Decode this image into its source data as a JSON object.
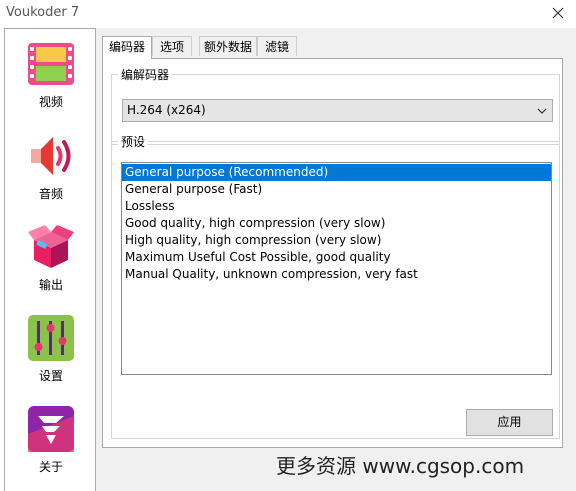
{
  "window": {
    "title": "Voukoder 7"
  },
  "sidebar": {
    "items": [
      {
        "label": "视频",
        "icon": "video-film-icon"
      },
      {
        "label": "音频",
        "icon": "speaker-icon"
      },
      {
        "label": "输出",
        "icon": "box-output-icon"
      },
      {
        "label": "设置",
        "icon": "sliders-settings-icon"
      },
      {
        "label": "关于",
        "icon": "about-logo-icon"
      }
    ]
  },
  "tabs": [
    {
      "label": "编码器",
      "active": true
    },
    {
      "label": "选项",
      "active": false
    },
    {
      "label": "额外数据",
      "active": false
    },
    {
      "label": "滤镜",
      "active": false
    }
  ],
  "encoder_group": {
    "label": "编解码器",
    "selected_value": "H.264 (x264)"
  },
  "preset_group": {
    "label": "预设",
    "items": [
      {
        "label": "General purpose (Recommended)",
        "selected": true
      },
      {
        "label": "General purpose (Fast)",
        "selected": false
      },
      {
        "label": "Lossless",
        "selected": false
      },
      {
        "label": "Good quality, high compression (very slow)",
        "selected": false
      },
      {
        "label": "High quality, high compression (very slow)",
        "selected": false
      },
      {
        "label": "Maximum Useful Cost Possible, good quality",
        "selected": false
      },
      {
        "label": "Manual Quality, unknown compression, very fast",
        "selected": false
      }
    ]
  },
  "apply_button": {
    "label": "应用"
  },
  "watermark": {
    "text": "更多资源 www.cgsop.com"
  },
  "colors": {
    "selection": "#0078d7",
    "panel_bg": "#f0f0f0",
    "accent_pink": "#e6386e"
  }
}
